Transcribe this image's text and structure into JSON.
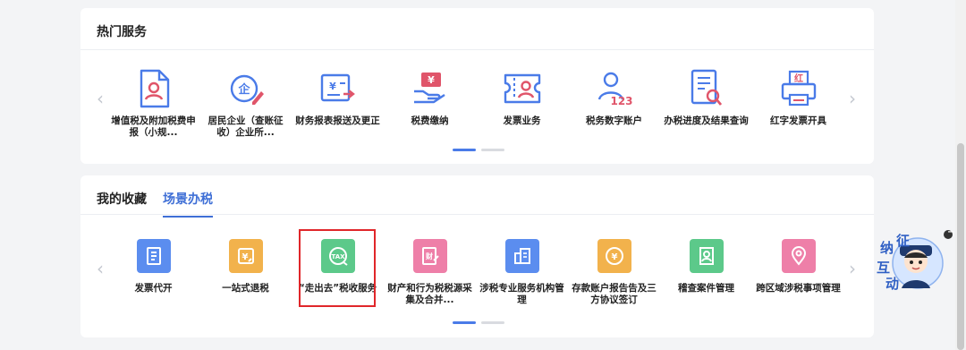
{
  "hot": {
    "title": "热门服务",
    "items": [
      {
        "label": "增值税及附加税费申报（小规...",
        "icon": "tax-form-person-icon"
      },
      {
        "label": "居民企业（查账征收）企业所...",
        "icon": "enterprise-edit-icon"
      },
      {
        "label": "财务报表报送及更正",
        "icon": "report-submit-icon"
      },
      {
        "label": "税费缴纳",
        "icon": "tax-payment-icon"
      },
      {
        "label": "发票业务",
        "icon": "invoice-person-icon"
      },
      {
        "label": "税务数字账户",
        "icon": "digital-account-icon"
      },
      {
        "label": "办税进度及结果查询",
        "icon": "progress-search-icon"
      },
      {
        "label": "红字发票开具",
        "icon": "red-invoice-printer-icon"
      }
    ],
    "printer_glyph": "红",
    "account_number": "123"
  },
  "fav": {
    "tabs": [
      {
        "label": "我的收藏",
        "active": false
      },
      {
        "label": "场景办税",
        "active": true
      }
    ],
    "items": [
      {
        "label": "发票代开",
        "icon": "invoice-issue-icon",
        "color": "#5b8def"
      },
      {
        "label": "一站式退税",
        "icon": "tax-refund-icon",
        "color": "#f2b24c"
      },
      {
        "label": "“走出去”税收服务",
        "icon": "tax-globe-icon",
        "color": "#5cc98a"
      },
      {
        "label": "财产和行为税税源采集及合并...",
        "icon": "property-tax-icon",
        "color": "#ee7fa8"
      },
      {
        "label": "涉税专业服务机构管理",
        "icon": "building-icon",
        "color": "#5b8def"
      },
      {
        "label": "存款账户报告告及三方协议签订",
        "icon": "bank-agreement-icon",
        "color": "#f2b24c"
      },
      {
        "label": "稽查案件管理",
        "icon": "case-management-icon",
        "color": "#5cc98a"
      },
      {
        "label": "跨区域涉税事项管理",
        "icon": "cross-region-icon",
        "color": "#ee7fa8"
      }
    ],
    "tax_glyph": "TAX"
  },
  "mascot": {
    "chars": [
      "征",
      "纳",
      "互",
      "动"
    ],
    "close_glyph": "−"
  },
  "colors": {
    "accent": "#3f6fd6",
    "icon_blue": "#4a7be8",
    "icon_red": "#e0556a",
    "highlight": "#e0262a"
  }
}
